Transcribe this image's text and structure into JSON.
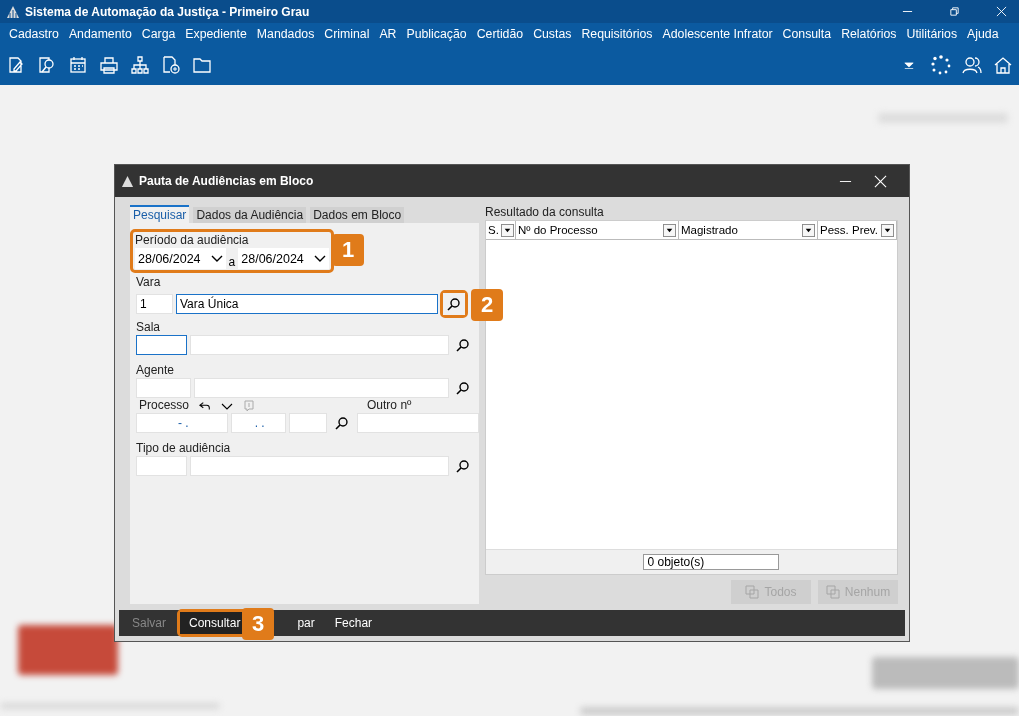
{
  "app": {
    "title": "Sistema de Automação da Justiça - Primeiro Grau"
  },
  "menu": [
    "Cadastro",
    "Andamento",
    "Carga",
    "Expediente",
    "Mandados",
    "Criminal",
    "AR",
    "Publicação",
    "Certidão",
    "Custas",
    "Requisitórios",
    "Adolescente Infrator",
    "Consulta",
    "Relatórios",
    "Utilitários",
    "Ajuda"
  ],
  "dialog": {
    "title": "Pauta de Audiências em Bloco",
    "tabs": [
      {
        "label": "Pesquisar",
        "selected": true
      },
      {
        "label": "Dados da Audiência",
        "selected": false
      },
      {
        "label": "Dados em Bloco",
        "selected": false
      }
    ],
    "period": {
      "label": "Período da audiência",
      "from": "28/06/2024",
      "connector": "a",
      "to": "28/06/2024",
      "callout": "1"
    },
    "vara": {
      "label": "Vara",
      "code": "1",
      "name": "Vara Única",
      "focused": true,
      "callout": "2"
    },
    "sala": {
      "label": "Sala",
      "focused": true
    },
    "agente": {
      "label": "Agente",
      "focused": false
    },
    "processo": {
      "label": "Processo",
      "mask_1": "- .",
      "mask_2": ". .",
      "other_label": "Outro nº"
    },
    "tipo": {
      "label": "Tipo de audiência",
      "focused": false
    },
    "results": {
      "title": "Resultado da consulta",
      "columns": [
        "S.",
        "Nº do Processo",
        "Magistrado",
        "Pess. Prev."
      ],
      "count": "0 objeto(s)",
      "buttons": [
        {
          "label": "Todos",
          "disabled": true
        },
        {
          "label": "Nenhum",
          "disabled": true
        }
      ]
    },
    "footer": [
      {
        "label": "Salvar",
        "disabled": true
      },
      {
        "label": "Consultar",
        "disabled": false,
        "callout": "3"
      },
      {
        "label": "par",
        "disabled": false
      },
      {
        "label": "Fechar",
        "disabled": false
      }
    ]
  }
}
